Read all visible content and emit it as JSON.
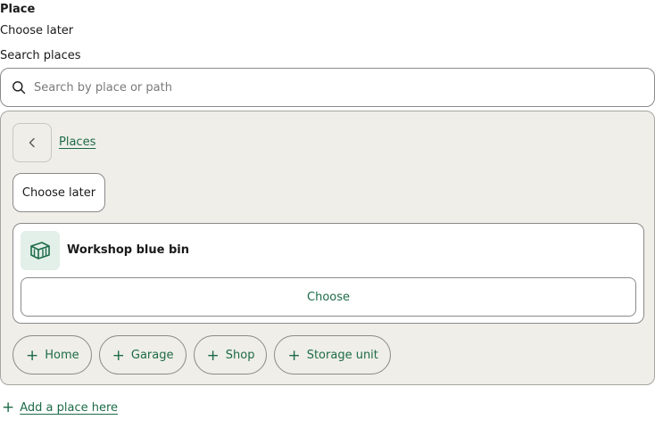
{
  "form": {
    "field_label": "Place",
    "current_value": "Choose later",
    "search_label": "Search places"
  },
  "search": {
    "placeholder": "Search by place or path",
    "value": ""
  },
  "browser": {
    "breadcrumb": "Places",
    "choose_later_label": "Choose later",
    "place": {
      "name": "Workshop blue bin",
      "icon": "bin-icon",
      "choose_label": "Choose"
    },
    "chips": [
      {
        "label": "Home"
      },
      {
        "label": "Garage"
      },
      {
        "label": "Shop"
      },
      {
        "label": "Storage unit"
      }
    ]
  },
  "footer": {
    "add_place_label": "Add a place here"
  },
  "colors": {
    "accent": "#1d6b48",
    "panel_bg": "#efeee8",
    "icon_bg": "#e3efe9"
  }
}
